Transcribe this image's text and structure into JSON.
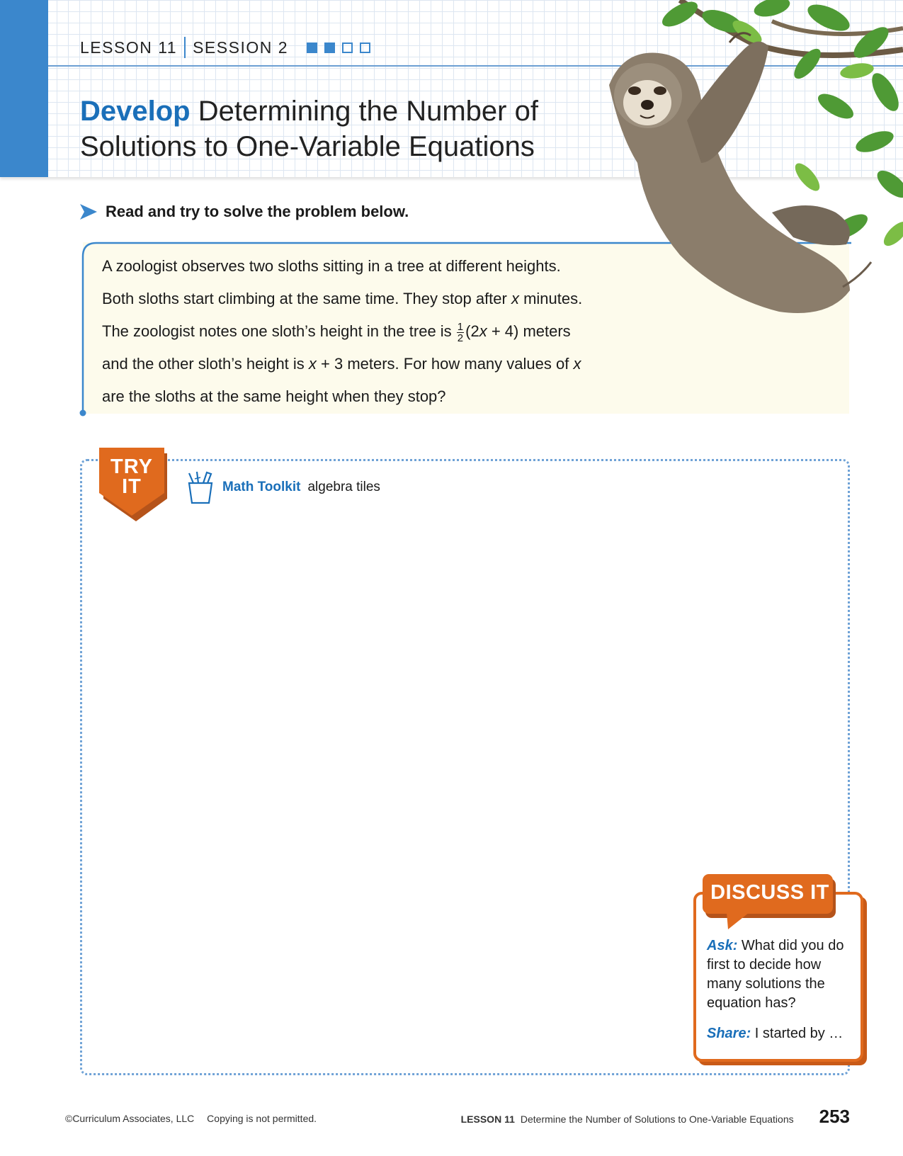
{
  "header": {
    "lesson": "LESSON 11",
    "session": "SESSION 2",
    "progress": {
      "total": 4,
      "completed": 2
    },
    "title_highlight": "Develop",
    "title_rest": "Determining the Number of Solutions to One-Variable Equations"
  },
  "instruction": "Read and try to solve the problem below.",
  "problem": {
    "line1": "A zoologist observes two sloths sitting in a tree at different heights.",
    "line2_before": "Both sloths start climbing at the same time. They stop after ",
    "line2_var": "x",
    "line2_after": " minutes.",
    "line3_before": "The zoologist notes one sloth’s height in the tree is ",
    "frac_num": "1",
    "frac_den": "2",
    "line3_expr_open": "(2",
    "line3_expr_var": "x",
    "line3_expr_close": " + 4) meters",
    "line4_before": "and the other sloth’s height is ",
    "line4_var": "x",
    "line4_mid": " + 3 meters. For how many values of ",
    "line4_var2": "x",
    "line5": "are the sloths at the same height when they stop?"
  },
  "try_it": {
    "label_line1": "TRY",
    "label_line2": "IT",
    "toolkit_title": "Math Toolkit",
    "toolkit_items": "algebra tiles"
  },
  "discuss": {
    "label": "DISCUSS IT",
    "ask_label": "Ask:",
    "ask_text": " What did you do first to decide how many solutions the equation has?",
    "share_label": "Share:",
    "share_text": " I started by …"
  },
  "footer": {
    "copyright": "©Curriculum Associates, LLC",
    "notice": "Copying is not permitted.",
    "lesson": "LESSON 11",
    "lesson_title": "Determine the Number of Solutions to One-Variable Equations",
    "page_number": "253"
  },
  "colors": {
    "accent_blue": "#3b87cc",
    "title_blue": "#1a6fb9",
    "orange": "#e06a1e",
    "problem_bg": "#fdfbec"
  }
}
